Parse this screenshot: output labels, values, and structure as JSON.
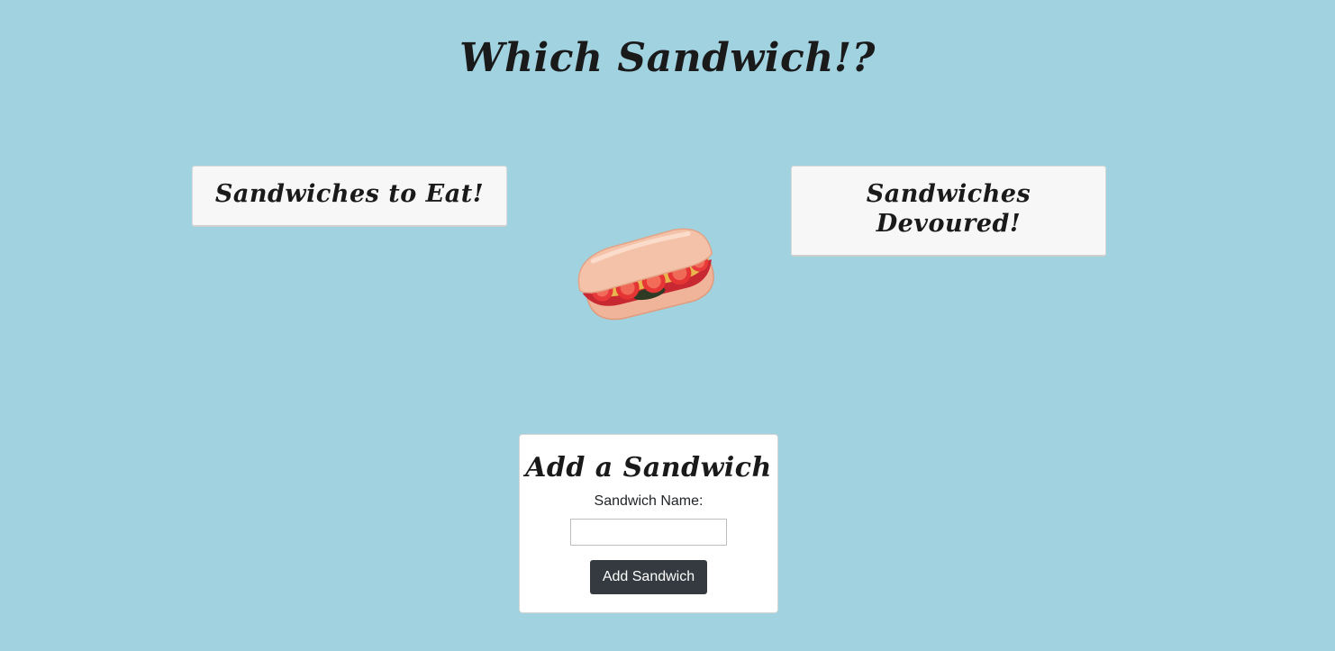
{
  "header": {
    "title": "Which Sandwich!?"
  },
  "columns": {
    "to_eat": {
      "heading": "Sandwiches to Eat!"
    },
    "devoured": {
      "heading": "Sandwiches Devoured!"
    }
  },
  "decor": {
    "image_icon": "sandwich-illustration"
  },
  "add_form": {
    "title": "Add a Sandwich",
    "name_label": "Sandwich Name:",
    "name_value": "",
    "name_placeholder": "",
    "submit_label": "Add Sandwich"
  },
  "colors": {
    "background": "#a0d2e0",
    "card_bg": "#f7f7f7",
    "button_bg": "#343a40",
    "button_text": "#ffffff"
  }
}
